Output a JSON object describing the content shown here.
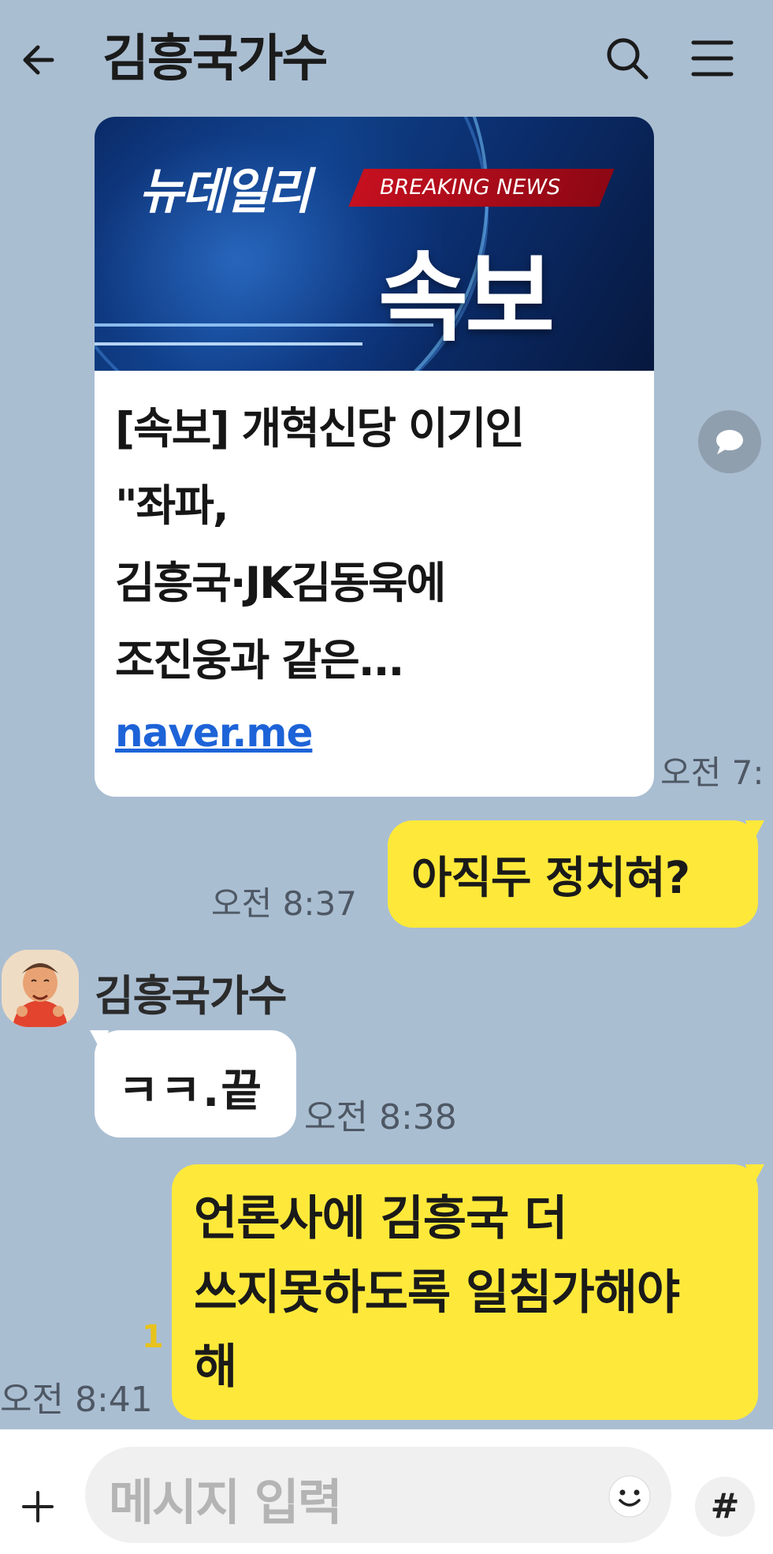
{
  "header": {
    "title": "김흥국가수"
  },
  "link_card": {
    "banner": {
      "brand": "뉴데일리",
      "breaking": "BREAKING NEWS",
      "headline": "속보"
    },
    "title_lines": [
      "[속보] 개혁신당 이기인",
      "\"좌파,",
      "김흥국·JK김동욱에",
      "조진웅과 같은..."
    ],
    "link": "naver.me",
    "time": "오전 7:"
  },
  "messages": [
    {
      "sender": "me",
      "text": "아직두 정치혀?",
      "time": "오전 8:37"
    },
    {
      "sender": "김흥국가수",
      "text": "ㅋㅋ.끝",
      "time": "오전 8:38"
    },
    {
      "sender": "me",
      "lines": [
        "언론사에 김흥국 더",
        "쓰지못하도록 일침가해야",
        "해"
      ],
      "unread": "1",
      "time": "오전 8:41"
    }
  ],
  "input": {
    "placeholder": "메시지 입력",
    "hash": "#"
  },
  "colors": {
    "background": "#aabed2",
    "my_bubble": "#fee93a",
    "other_bubble": "#ffffff",
    "link": "#1d63d8"
  }
}
